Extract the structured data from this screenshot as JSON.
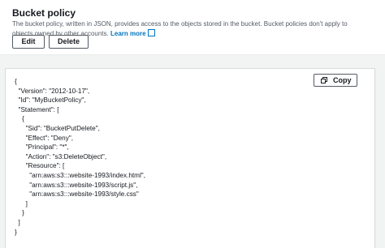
{
  "header": {
    "title": "Bucket policy",
    "description": "The bucket policy, written in JSON, provides access to the objects stored in the bucket. Bucket policies don't apply to objects owned by other accounts.",
    "learn_more": "Learn more",
    "external_icon": "external-link-icon"
  },
  "actions": {
    "edit_label": "Edit",
    "delete_label": "Delete"
  },
  "editor": {
    "copy_label": "Copy",
    "copy_icon": "copy-icon",
    "policy_text": "{\n  \"Version\": \"2012-10-17\",\n  \"Id\": \"MyBucketPolicy\",\n  \"Statement\": [\n    {\n      \"Sid\": \"BucketPutDelete\",\n      \"Effect\": \"Deny\",\n      \"Principal\": \"*\",\n      \"Action\": \"s3:DeleteObject\",\n      \"Resource\": [\n        \"arn:aws:s3:::website-1993/index.html\",\n        \"arn:aws:s3:::website-1993/script.js\",\n        \"arn:aws:s3:::website-1993/style.css\"\n      ]\n    }\n  ]\n}"
  }
}
